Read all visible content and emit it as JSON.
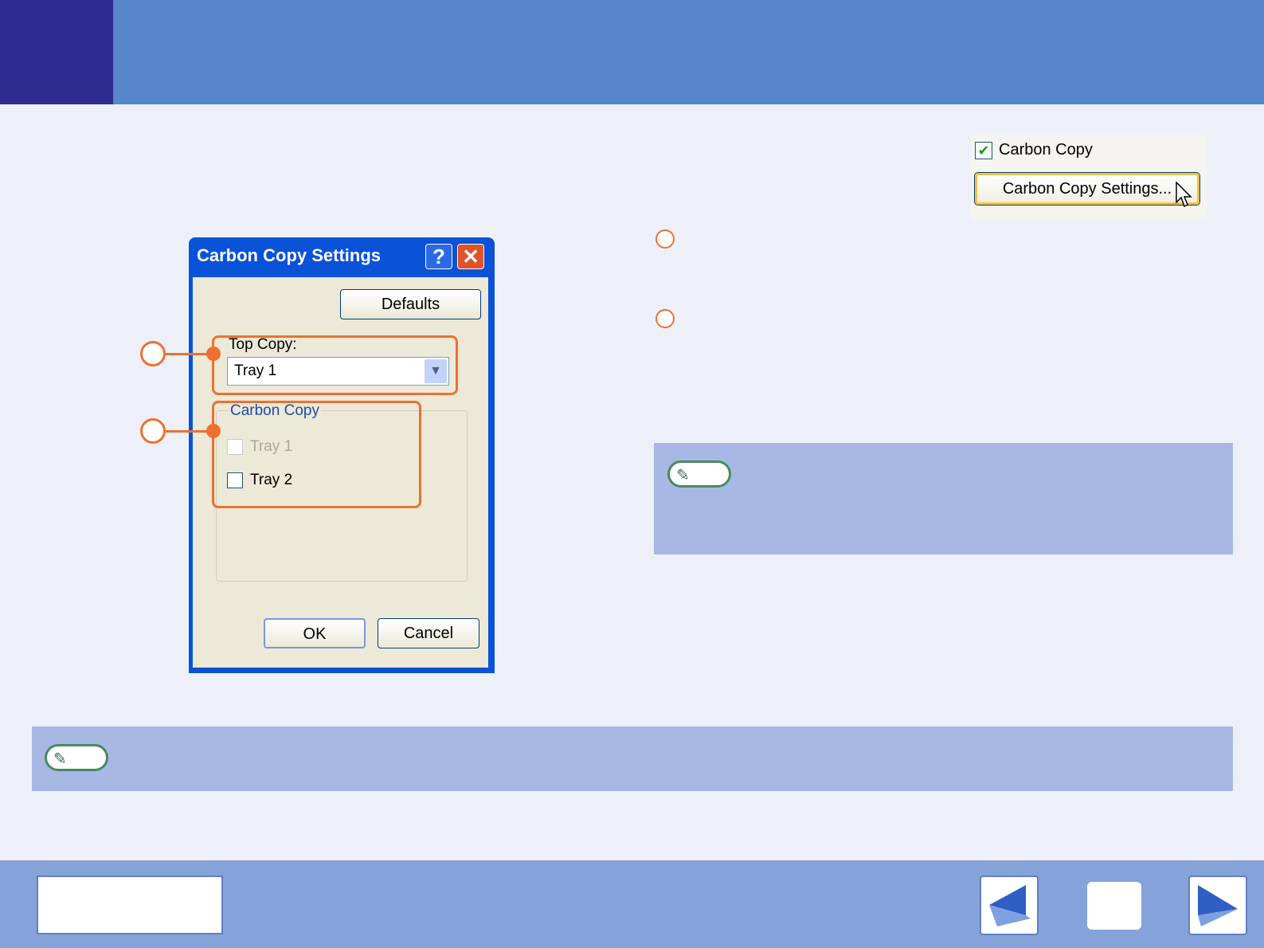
{
  "dialog": {
    "title": "Carbon Copy Settings",
    "help_icon": "?",
    "close_icon": "✕",
    "defaults_button": "Defaults",
    "top_copy_label": "Top Copy:",
    "top_copy_value": "Tray 1",
    "carbon_copy_group": "Carbon Copy",
    "tray1_label": "Tray 1",
    "tray2_label": "Tray 2",
    "ok_button": "OK",
    "cancel_button": "Cancel"
  },
  "right_panel": {
    "carbon_copy_checkbox_label": "Carbon Copy",
    "carbon_copy_checked": true,
    "carbon_copy_settings_button": "Carbon Copy Settings..."
  },
  "icons": {
    "note_badge": "pencil-icon",
    "prev": "left-arrow-icon",
    "next": "right-arrow-icon",
    "checkmark": "✔",
    "select_arrow": "▼",
    "pencil_glyph": "✎"
  },
  "colors": {
    "header": "#5886cb",
    "header_square": "#2d2c8f",
    "footer": "#85a3d8",
    "callout": "#ee7030",
    "note_panel": "#a8b8e4"
  }
}
